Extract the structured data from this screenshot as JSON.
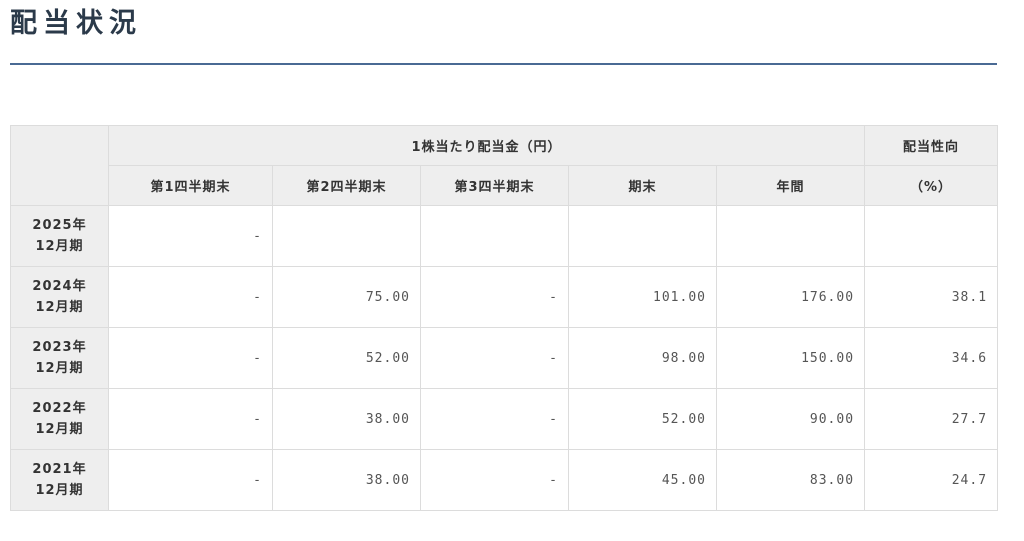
{
  "page": {
    "title": "配当状況"
  },
  "table": {
    "group_header": "1株当たり配当金（円）",
    "payout_header_top": "配当性向",
    "payout_header_bottom": "（%）",
    "columns": [
      "第1四半期末",
      "第2四半期末",
      "第3四半期末",
      "期末",
      "年間"
    ],
    "rows": [
      {
        "year": "2025年",
        "term": "12月期",
        "cells": [
          "-",
          "",
          "",
          "",
          "",
          ""
        ]
      },
      {
        "year": "2024年",
        "term": "12月期",
        "cells": [
          "-",
          "75.00",
          "-",
          "101.00",
          "176.00",
          "38.1"
        ]
      },
      {
        "year": "2023年",
        "term": "12月期",
        "cells": [
          "-",
          "52.00",
          "-",
          "98.00",
          "150.00",
          "34.6"
        ]
      },
      {
        "year": "2022年",
        "term": "12月期",
        "cells": [
          "-",
          "38.00",
          "-",
          "52.00",
          "90.00",
          "27.7"
        ]
      },
      {
        "year": "2021年",
        "term": "12月期",
        "cells": [
          "-",
          "38.00",
          "-",
          "45.00",
          "83.00",
          "24.7"
        ]
      }
    ]
  }
}
